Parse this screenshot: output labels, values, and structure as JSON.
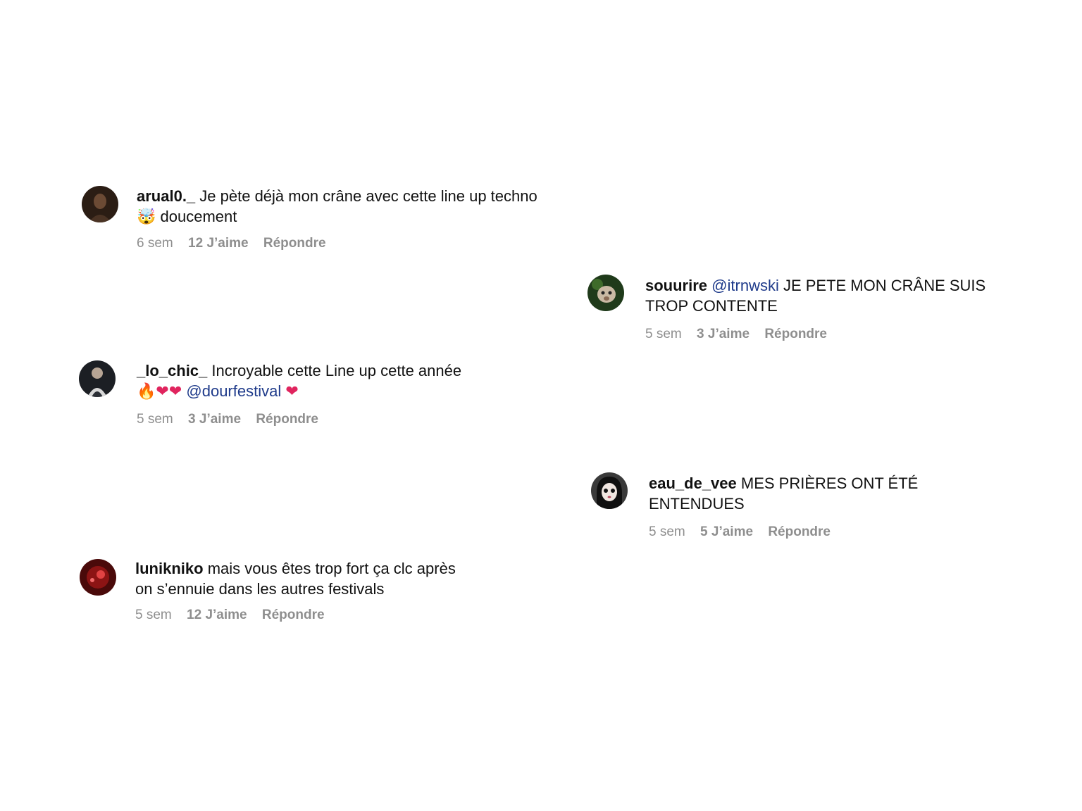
{
  "comments": [
    {
      "username": "arual0._",
      "text_line1": "Je pète déjà mon crâne avec cette line up techno",
      "emoji_prefix_line2": "🤯",
      "text_line2": "doucement",
      "time": "6 sem",
      "likes": "12 J’aime",
      "reply": "Répondre",
      "avatar_icon": "avatar-dark-portrait"
    },
    {
      "username": "souurire",
      "mention": "@itrnwski",
      "text_line1": "JE PETE MON CRÂNE SUIS",
      "text_line2": "TROP CONTENTE",
      "time": "5 sem",
      "likes": "3 J’aime",
      "reply": "Répondre",
      "avatar_icon": "avatar-animal-green"
    },
    {
      "username": "_lo_chic_",
      "text_line1": "Incroyable cette Line up cette année",
      "emojis_line2_a": "🔥❤❤",
      "mention": "@dourfestival",
      "emojis_line2_b": "❤",
      "time": "5 sem",
      "likes": "3 J’aime",
      "reply": "Répondre",
      "avatar_icon": "avatar-person-dark"
    },
    {
      "username": "eau_de_vee",
      "text_line1": "MES PRIÈRES ONT ÉTÉ",
      "text_line2": "ENTENDUES",
      "time": "5 sem",
      "likes": "5 J’aime",
      "reply": "Répondre",
      "avatar_icon": "avatar-doll-face"
    },
    {
      "username": "lunikniko",
      "text_line1": "mais vous êtes trop fort ça clc après",
      "text_line2": "on s’ennuie dans les autres festivals",
      "time": "5 sem",
      "likes": "12 J’aime",
      "reply": "Répondre",
      "avatar_icon": "avatar-red-lights"
    }
  ],
  "colors": {
    "text": "#111111",
    "meta": "#8e8e8e",
    "mention": "#1e3a8a",
    "heart": "#e0245e"
  }
}
